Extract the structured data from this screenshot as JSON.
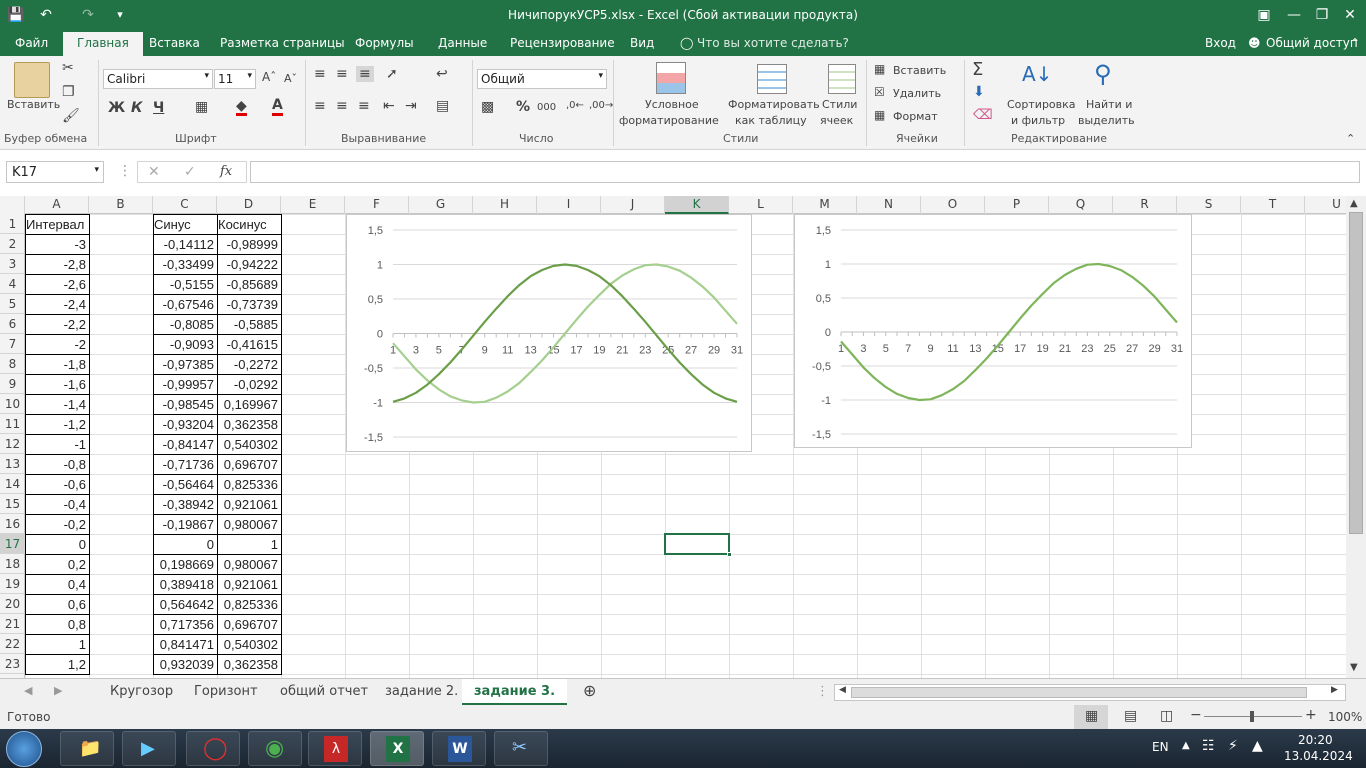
{
  "window": {
    "title": "НичипорукУСР5.xlsx - Excel (Сбой активации продукта)"
  },
  "ribbon_tabs": [
    "Файл",
    "Главная",
    "Вставка",
    "Разметка страницы",
    "Формулы",
    "Данные",
    "Рецензирование",
    "Вид"
  ],
  "tell_me": "Что вы хотите сделать?",
  "signin": "Вход",
  "share": "Общий доступ",
  "clipboard": {
    "paste": "Вставить",
    "label": "Буфер обмена"
  },
  "font": {
    "name": "Calibri",
    "size": "11",
    "label": "Шрифт",
    "bold": "Ж",
    "italic": "К",
    "underline": "Ч"
  },
  "alignment": {
    "label": "Выравнивание"
  },
  "number": {
    "format": "Общий",
    "label": "Число",
    "percent": "%",
    "thousands": "000"
  },
  "styles": {
    "cond_line1": "Условное",
    "cond_line2": "форматирование",
    "table_line1": "Форматировать",
    "table_line2": "как таблицу",
    "cell_line1": "Стили",
    "cell_line2": "ячеек",
    "label": "Стили"
  },
  "cells": {
    "insert": "Вставить",
    "delete": "Удалить",
    "format": "Формат",
    "label": "Ячейки"
  },
  "editing": {
    "sort_line1": "Сортировка",
    "sort_line2": "и фильтр",
    "find_line1": "Найти и",
    "find_line2": "выделить",
    "label": "Редактирование"
  },
  "formula_bar": {
    "name_box": "K17",
    "fx": "fx",
    "value": ""
  },
  "columns": [
    "A",
    "B",
    "C",
    "D",
    "E",
    "F",
    "G",
    "H",
    "I",
    "J",
    "K",
    "L",
    "M",
    "N",
    "O",
    "P",
    "Q",
    "R",
    "S",
    "T",
    "U"
  ],
  "selected_column": "K",
  "selected_row": "17",
  "rows": [
    "1",
    "2",
    "3",
    "4",
    "5",
    "6",
    "7",
    "8",
    "9",
    "10",
    "11",
    "12",
    "13",
    "14",
    "15",
    "16",
    "17",
    "18",
    "19",
    "20",
    "21",
    "22",
    "23"
  ],
  "table": {
    "headers": {
      "a": "Интервал",
      "c": "Синус",
      "d": "Косинус"
    },
    "data": [
      [
        "-3",
        "-0,14112",
        "-0,98999"
      ],
      [
        "-2,8",
        "-0,33499",
        "-0,94222"
      ],
      [
        "-2,6",
        "-0,5155",
        "-0,85689"
      ],
      [
        "-2,4",
        "-0,67546",
        "-0,73739"
      ],
      [
        "-2,2",
        "-0,8085",
        "-0,5885"
      ],
      [
        "-2",
        "-0,9093",
        "-0,41615"
      ],
      [
        "-1,8",
        "-0,97385",
        "-0,2272"
      ],
      [
        "-1,6",
        "-0,99957",
        "-0,0292"
      ],
      [
        "-1,4",
        "-0,98545",
        "0,169967"
      ],
      [
        "-1,2",
        "-0,93204",
        "0,362358"
      ],
      [
        "-1",
        "-0,84147",
        "0,540302"
      ],
      [
        "-0,8",
        "-0,71736",
        "0,696707"
      ],
      [
        "-0,6",
        "-0,56464",
        "0,825336"
      ],
      [
        "-0,4",
        "-0,38942",
        "0,921061"
      ],
      [
        "-0,2",
        "-0,19867",
        "0,980067"
      ],
      [
        "0",
        "0",
        "1"
      ],
      [
        "0,2",
        "0,198669",
        "0,980067"
      ],
      [
        "0,4",
        "0,389418",
        "0,921061"
      ],
      [
        "0,6",
        "0,564642",
        "0,825336"
      ],
      [
        "0,8",
        "0,717356",
        "0,696707"
      ],
      [
        "1",
        "0,841471",
        "0,540302"
      ],
      [
        "1,2",
        "0,932039",
        "0,362358"
      ]
    ]
  },
  "chart_data": [
    {
      "type": "line",
      "title": "",
      "ylim": [
        -1.5,
        1.5
      ],
      "yticks": [
        "1,5",
        "1",
        "0,5",
        "0",
        "-0,5",
        "-1",
        "-1,5"
      ],
      "xticks": [
        "1",
        "3",
        "5",
        "7",
        "9",
        "11",
        "13",
        "15",
        "17",
        "19",
        "21",
        "23",
        "25",
        "27",
        "29",
        "31"
      ],
      "x": [
        1,
        2,
        3,
        4,
        5,
        6,
        7,
        8,
        9,
        10,
        11,
        12,
        13,
        14,
        15,
        16,
        17,
        18,
        19,
        20,
        21,
        22,
        23,
        24,
        25,
        26,
        27,
        28,
        29,
        30,
        31
      ],
      "grid": true,
      "series": [
        {
          "values": [
            -0.14,
            -0.33,
            -0.52,
            -0.68,
            -0.81,
            -0.91,
            -0.97,
            -1.0,
            -0.99,
            -0.93,
            -0.84,
            -0.72,
            -0.56,
            -0.39,
            -0.2,
            0,
            0.2,
            0.39,
            0.56,
            0.72,
            0.84,
            0.93,
            0.99,
            1.0,
            0.97,
            0.91,
            0.81,
            0.68,
            0.52,
            0.33,
            0.14
          ],
          "color": "#a5cf8e"
        },
        {
          "values": [
            -0.99,
            -0.94,
            -0.86,
            -0.74,
            -0.59,
            -0.42,
            -0.23,
            -0.03,
            0.17,
            0.36,
            0.54,
            0.7,
            0.83,
            0.92,
            0.98,
            1,
            0.98,
            0.92,
            0.83,
            0.7,
            0.54,
            0.36,
            0.17,
            -0.03,
            -0.23,
            -0.42,
            -0.59,
            -0.74,
            -0.86,
            -0.94,
            -0.99
          ],
          "color": "#6a9e48"
        }
      ]
    },
    {
      "type": "line",
      "title": "",
      "ylim": [
        -1.5,
        1.5
      ],
      "yticks": [
        "1,5",
        "1",
        "0,5",
        "0",
        "-0,5",
        "-1",
        "-1,5"
      ],
      "xticks": [
        "1",
        "3",
        "5",
        "7",
        "9",
        "11",
        "13",
        "15",
        "17",
        "19",
        "21",
        "23",
        "25",
        "27",
        "29",
        "31"
      ],
      "x": [
        1,
        2,
        3,
        4,
        5,
        6,
        7,
        8,
        9,
        10,
        11,
        12,
        13,
        14,
        15,
        16,
        17,
        18,
        19,
        20,
        21,
        22,
        23,
        24,
        25,
        26,
        27,
        28,
        29,
        30,
        31
      ],
      "grid": true,
      "series": [
        {
          "values": [
            -0.14,
            -0.33,
            -0.52,
            -0.68,
            -0.81,
            -0.91,
            -0.97,
            -1.0,
            -0.99,
            -0.93,
            -0.84,
            -0.72,
            -0.56,
            -0.39,
            -0.2,
            0,
            0.2,
            0.39,
            0.56,
            0.72,
            0.84,
            0.93,
            0.99,
            1.0,
            0.97,
            0.91,
            0.81,
            0.68,
            0.52,
            0.33,
            0.14
          ],
          "color": "#7fb55a"
        }
      ]
    }
  ],
  "sheets": [
    "Кругозор",
    "Горизонт",
    "общий отчет",
    "задание 2.",
    "задание 3."
  ],
  "active_sheet": "задание 3.",
  "status": {
    "ready": "Готово",
    "zoom": "100%"
  },
  "taskbar": {
    "lang": "EN",
    "time": "20:20",
    "date": "13.04.2024"
  },
  "colors": {
    "excel_green": "#217346",
    "accent": "#217346"
  }
}
